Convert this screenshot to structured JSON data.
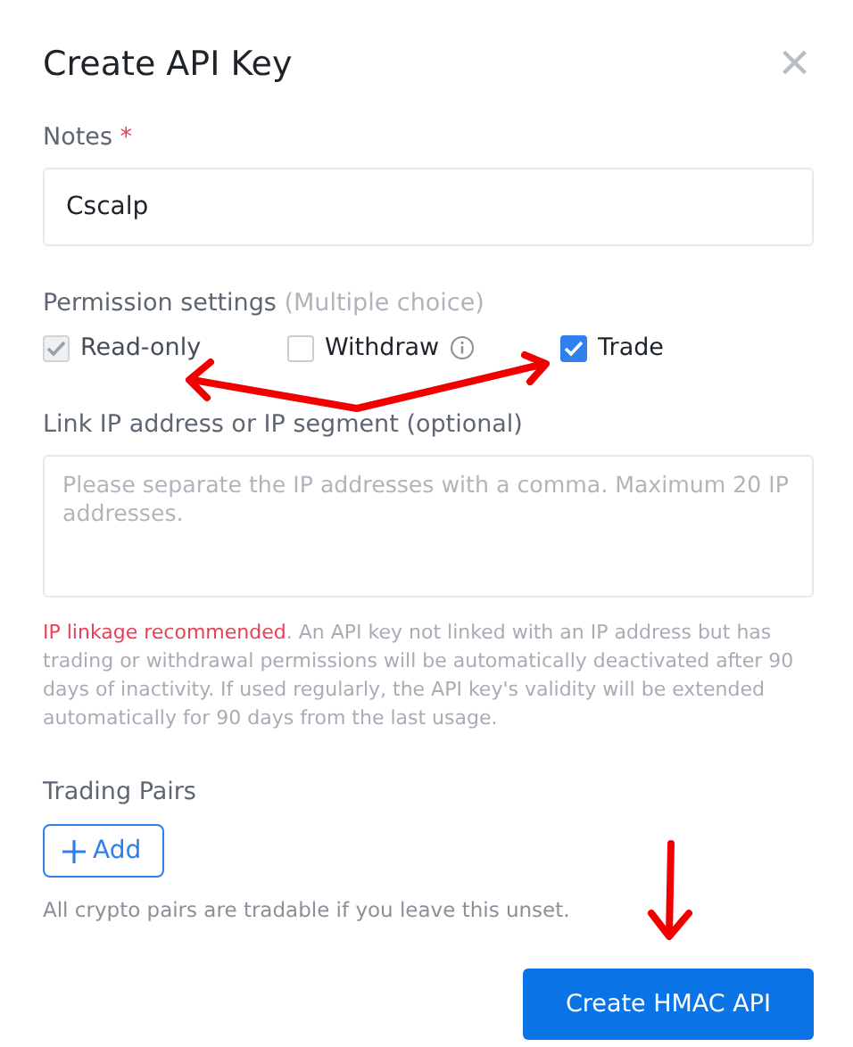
{
  "dialog": {
    "title": "Create API Key",
    "close": "×"
  },
  "notes": {
    "label": "Notes",
    "required_mark": "*",
    "value": "Cscalp"
  },
  "permissions": {
    "label": "Permission settings",
    "hint": "(Multiple choice)",
    "options": [
      {
        "label": "Read-only",
        "checked": true,
        "disabled": true,
        "info": false
      },
      {
        "label": "Withdraw",
        "checked": false,
        "disabled": false,
        "info": true
      },
      {
        "label": "Trade",
        "checked": true,
        "disabled": false,
        "info": false
      }
    ]
  },
  "ip": {
    "label": "Link IP address or IP segment (optional)",
    "placeholder": "Please separate the IP addresses with a comma. Maximum 20 IP addresses.",
    "warning_lead": "IP linkage recommended",
    "warning_text": ". An API key not linked with an IP address but has trading or withdrawal permissions will be automatically deactivated after 90 days of inactivity. If used regularly, the API key's validity will be extended automatically for 90 days from the last usage."
  },
  "trading_pairs": {
    "label": "Trading Pairs",
    "add_button": "Add",
    "hint": "All crypto pairs are tradable if you leave this unset."
  },
  "submit": "Create HMAC API"
}
